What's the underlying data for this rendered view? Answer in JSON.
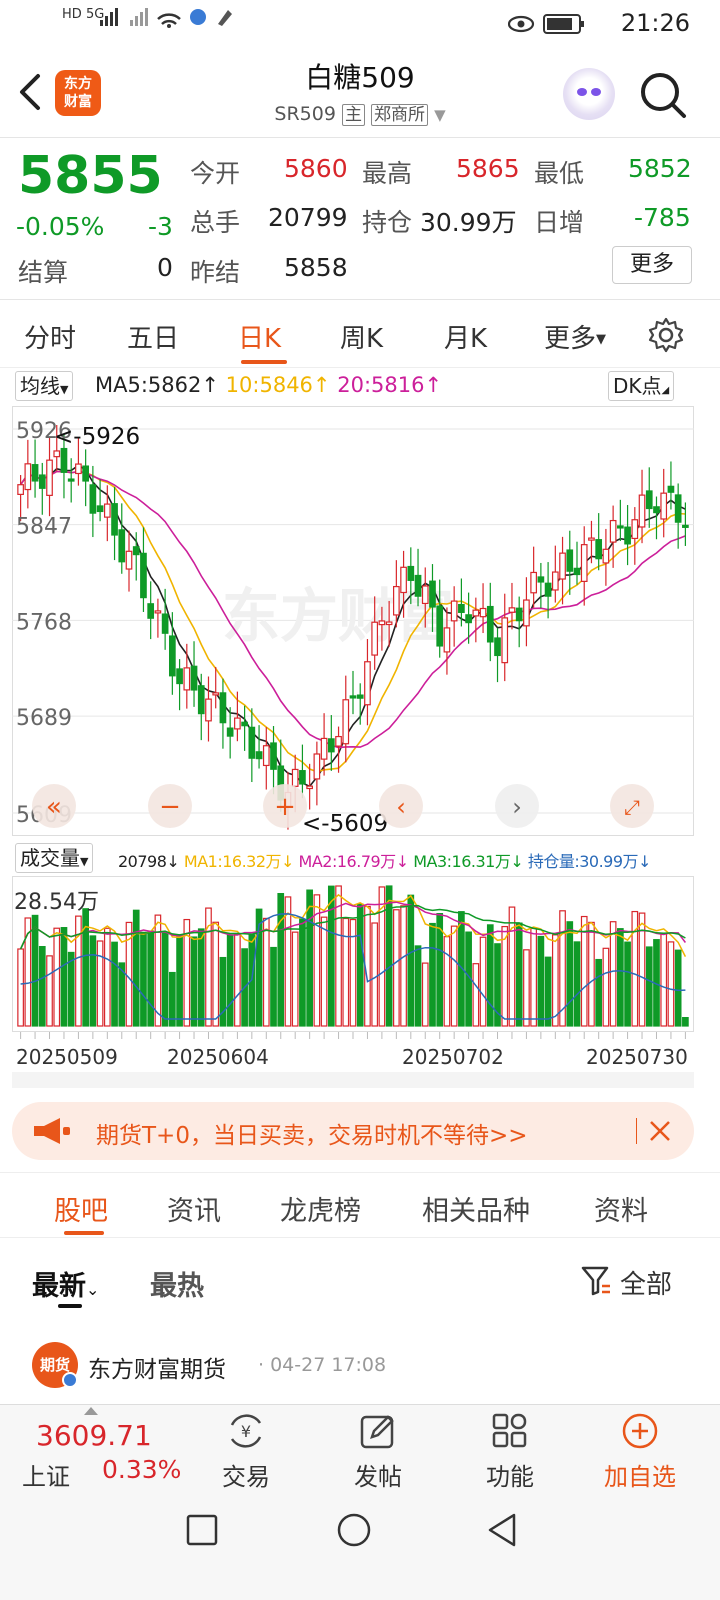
{
  "status_bar": {
    "left_top": "HD",
    "left_bottom": "5G",
    "time": "21:26"
  },
  "header": {
    "logo_line1": "东方",
    "logo_line2": "财富",
    "title": "白糖509",
    "code": "SR509",
    "tag_main": "主",
    "exchange": "郑商所"
  },
  "quote": {
    "price": "5855",
    "change_pct": "-0.05%",
    "change": "-3",
    "settle_label": "结算",
    "settle": "0",
    "open_label": "今开",
    "open": "5860",
    "high_label": "最高",
    "high": "5865",
    "low_label": "最低",
    "low": "5852",
    "volume_label": "总手",
    "volume": "20799",
    "oi_label": "持仓",
    "oi": "30.99万",
    "daily_inc_label": "日增",
    "daily_inc": "-785",
    "prev_settle_label": "昨结",
    "prev_settle": "5858",
    "more_label": "更多"
  },
  "period_tabs": [
    "分时",
    "五日",
    "日K",
    "周K",
    "月K",
    "更多"
  ],
  "active_tab": "日K",
  "kline": {
    "indicator_btn": "均线",
    "ma5": "MA5:5862",
    "ma10": "10:5846",
    "ma20": "20:5816",
    "dk_btn": "DK点",
    "y_labels": [
      "5926",
      "5847",
      "5768",
      "5689",
      "5609"
    ],
    "max_marker": "<-5926",
    "min_marker": "<-5609",
    "watermark": "东方财富"
  },
  "volume": {
    "indicator_btn": "成交量",
    "vol_value": "20798",
    "ma1": "MA1:16.32万",
    "ma2": "MA2:16.79万",
    "ma3": "MA3:16.31万",
    "oi": "持仓量:30.99万",
    "y_top": "28.54万",
    "x_labels": [
      "20250509",
      "20250604",
      "20250702",
      "20250730"
    ]
  },
  "banner": {
    "text": "期货T+0，当日买卖，交易时机不等待>>"
  },
  "community_tabs": [
    "股吧",
    "资讯",
    "龙虎榜",
    "相关品种",
    "资料"
  ],
  "feed": {
    "latest": "最新",
    "hot": "最热",
    "filter": "全部"
  },
  "post": {
    "avatar_text": "期货",
    "author": "东方财富期货",
    "time": "· 04-27 17:08"
  },
  "bottom_nav": {
    "index_value": "3609.71",
    "index_name": "上证",
    "index_change": "0.33%",
    "items": [
      "交易",
      "发帖",
      "功能",
      "加自选"
    ]
  },
  "colors": {
    "up": "#d8262b",
    "down": "#0f9a27",
    "accent": "#e8561a",
    "ma5": "#222222",
    "ma10": "#f0b400",
    "ma20": "#cc1f9a"
  }
}
